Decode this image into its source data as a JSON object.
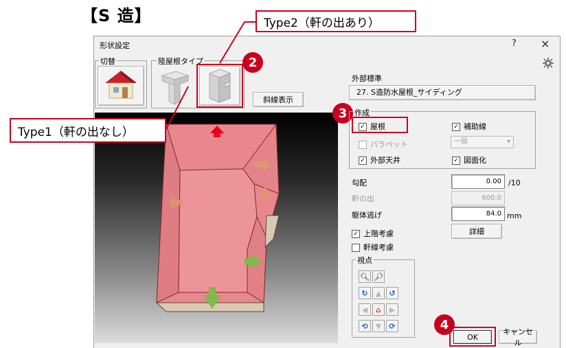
{
  "heading": "【S 造】",
  "callouts": {
    "type2": "Type2（軒の出あり）",
    "type1": "Type1（軒の出なし）"
  },
  "badges": {
    "b2": "2",
    "b3": "3",
    "b4": "4"
  },
  "dialog": {
    "title": "形状設定",
    "help": "?",
    "close": "×",
    "switch_group": "切替",
    "roof_type_group": "陸屋根タイプ",
    "diagonal_button": "斜線表示",
    "exterior_label": "外部標準",
    "exterior_value": "27. S造防水屋根_サイディング",
    "create_group": "作成",
    "check_roof": "屋根",
    "check_aux": "補助線",
    "check_parapet": "パラペット",
    "parapet_select": "一般",
    "check_ceiling": "外部天井",
    "check_drawing": "図面化",
    "slope_label": "勾配",
    "slope_value": "0.00",
    "slope_unit": "/10",
    "eave_label": "軒の出",
    "eave_value": "600.0",
    "offset_label": "躯体逃げ",
    "offset_value": "84.0",
    "offset_unit": "mm",
    "detail_button": "詳細",
    "check_upper": "上階考慮",
    "check_eave_line": "軒線考慮",
    "view_group": "視点",
    "ok_button": "OK",
    "cancel_button": "キャンセル"
  },
  "checks": {
    "roof": true,
    "aux": true,
    "parapet": false,
    "ceiling": true,
    "drawing": true,
    "upper": true,
    "eave_line": false
  },
  "colors": {
    "accent_red": "#c8001e",
    "roof_pink": "#e8888e",
    "arrow_green": "#7fba4a"
  }
}
